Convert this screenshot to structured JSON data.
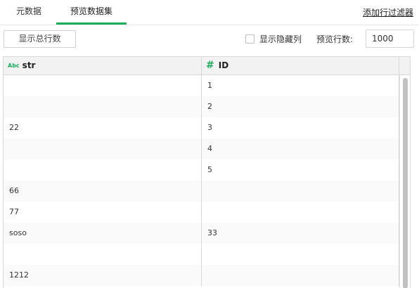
{
  "tabs": [
    {
      "label": "元数据"
    },
    {
      "label": "预览数据集"
    }
  ],
  "filter_link": "添加行过滤器",
  "toolbar": {
    "show_total_label": "显示总行数",
    "show_hidden_label": "显示隐藏列",
    "preview_rows_label": "预览行数:",
    "preview_rows_value": "1000"
  },
  "table": {
    "columns": [
      {
        "type_icon": "Abc",
        "name": "str"
      },
      {
        "type_icon": "#",
        "name": "ID"
      }
    ],
    "rows": [
      [
        "",
        "1"
      ],
      [
        "",
        "2"
      ],
      [
        "22",
        "3"
      ],
      [
        "",
        "4"
      ],
      [
        "",
        "5"
      ],
      [
        "66",
        ""
      ],
      [
        "77",
        ""
      ],
      [
        "soso",
        "33"
      ],
      [
        "",
        ""
      ],
      [
        "1212",
        ""
      ]
    ]
  },
  "colors": {
    "accent": "#1aab5d"
  }
}
